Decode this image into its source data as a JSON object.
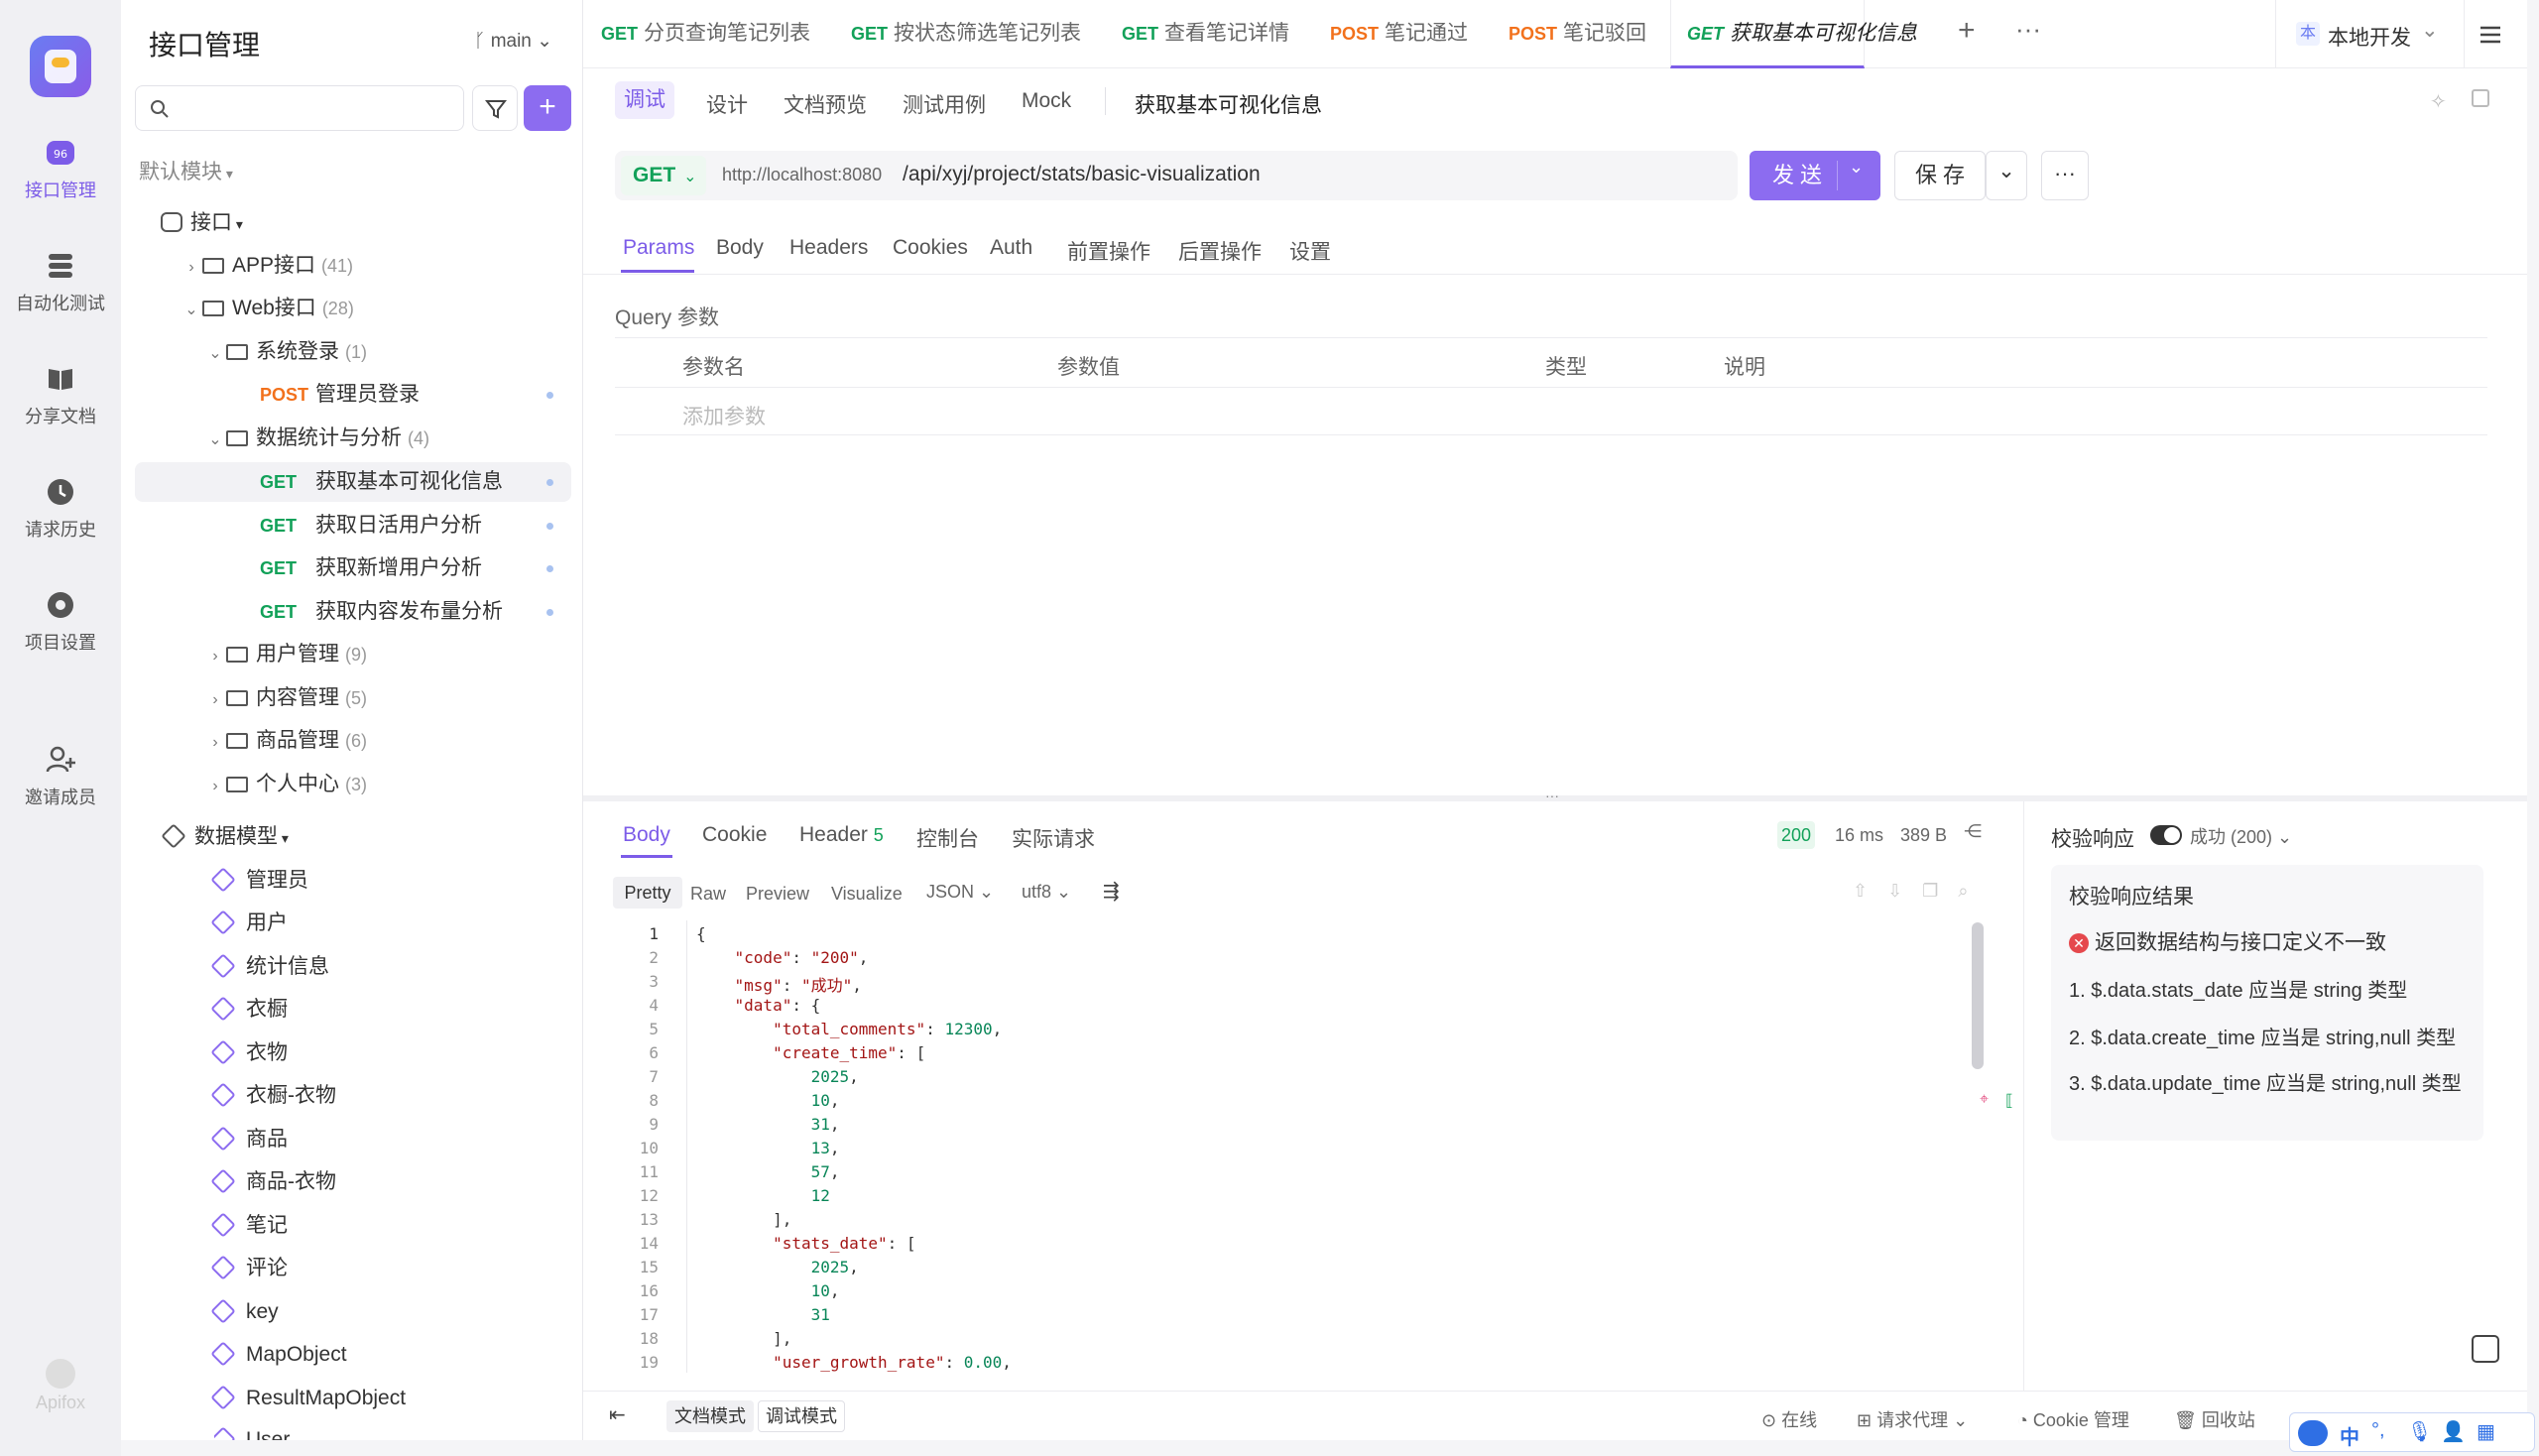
{
  "rail": {
    "items": [
      {
        "label": "接口管理",
        "icon": "api-icon"
      },
      {
        "label": "自动化测试",
        "icon": "automation-icon"
      },
      {
        "label": "分享文档",
        "icon": "book-icon"
      },
      {
        "label": "请求历史",
        "icon": "clock-icon"
      },
      {
        "label": "项目设置",
        "icon": "gear-icon"
      },
      {
        "label": "邀请成员",
        "icon": "add-user-icon"
      }
    ],
    "brand": "Apifox"
  },
  "tree": {
    "title": "接口管理",
    "branch": "main",
    "module": "默认模块",
    "root": "接口",
    "app": {
      "label": "APP接口",
      "count": "(41)"
    },
    "web": {
      "label": "Web接口",
      "count": "(28)"
    },
    "login_folder": {
      "label": "系统登录",
      "count": "(1)"
    },
    "login_item": {
      "method": "POST",
      "label": "管理员登录"
    },
    "stats_folder": {
      "label": "数据统计与分析",
      "count": "(4)"
    },
    "stats_items": [
      {
        "method": "GET",
        "label": "获取基本可视化信息"
      },
      {
        "method": "GET",
        "label": "获取日活用户分析"
      },
      {
        "method": "GET",
        "label": "获取新增用户分析"
      },
      {
        "method": "GET",
        "label": "获取内容发布量分析"
      }
    ],
    "folders": [
      {
        "label": "用户管理",
        "count": "(9)"
      },
      {
        "label": "内容管理",
        "count": "(5)"
      },
      {
        "label": "商品管理",
        "count": "(6)"
      },
      {
        "label": "个人中心",
        "count": "(3)"
      }
    ],
    "models_title": "数据模型",
    "models": [
      "管理员",
      "用户",
      "统计信息",
      "衣橱",
      "衣物",
      "衣橱-衣物",
      "商品",
      "商品-衣物",
      "笔记",
      "评论",
      "key",
      "MapObject",
      "ResultMapObject",
      "User"
    ]
  },
  "tabs": [
    {
      "method": "GET",
      "label": "分页查询笔记列表"
    },
    {
      "method": "GET",
      "label": "按状态筛选笔记列表"
    },
    {
      "method": "GET",
      "label": "查看笔记详情"
    },
    {
      "method": "POST",
      "label": "笔记通过"
    },
    {
      "method": "POST",
      "label": "笔记驳回"
    },
    {
      "method": "GET",
      "label": "获取基本可视化信息"
    }
  ],
  "env": {
    "badge": "本",
    "label": "本地开发"
  },
  "subtabs": [
    "调试",
    "设计",
    "文档预览",
    "测试用例",
    "Mock"
  ],
  "api_name": "获取基本可视化信息",
  "request": {
    "method": "GET",
    "base": "http://localhost:8080",
    "path": "/api/xyj/project/stats/basic-visualization",
    "send": "发 送",
    "save": "保 存"
  },
  "param_tabs": [
    "Params",
    "Body",
    "Headers",
    "Cookies",
    "Auth",
    "前置操作",
    "后置操作",
    "设置"
  ],
  "query": {
    "title": "Query 参数",
    "cols": [
      "参数名",
      "参数值",
      "类型",
      "说明"
    ],
    "placeholder": "添加参数"
  },
  "response": {
    "tabs": [
      "Body",
      "Cookie",
      "Header",
      "控制台",
      "实际请求"
    ],
    "header_count": "5",
    "status": "200",
    "time": "16 ms",
    "size": "389 B",
    "views": [
      "Pretty",
      "Raw",
      "Preview",
      "Visualize"
    ],
    "format": "JSON",
    "encoding": "utf8",
    "lines": [
      "{",
      "    \"code\": \"200\",",
      "    \"msg\": \"成功\",",
      "    \"data\": {",
      "        \"total_comments\": 12300,",
      "        \"create_time\": [",
      "            2025,",
      "            10,",
      "            31,",
      "            13,",
      "            57,",
      "            12",
      "        ],",
      "        \"stats_date\": [",
      "            2025,",
      "            10,",
      "            31",
      "        ],",
      "        \"user_growth_rate\": 0.00,"
    ]
  },
  "validation": {
    "label": "校验响应",
    "value": "成功 (200)",
    "title": "校验响应结果",
    "error": "返回数据结构与接口定义不一致",
    "items": [
      "1. $.data.stats_date 应当是 string 类型",
      "2. $.data.create_time 应当是 string,null 类型",
      "3. $.data.update_time 应当是 string,null 类型"
    ]
  },
  "footer": {
    "doc_mode": "文档模式",
    "debug_mode": "调试模式",
    "online": "在线",
    "proxy": "请求代理",
    "cookie": "Cookie 管理",
    "recycle": "回收站",
    "ime": [
      "中",
      "°,"
    ]
  },
  "colors": {
    "accent": "#7c5ce8",
    "get": "#12a159",
    "post": "#f2711c"
  }
}
